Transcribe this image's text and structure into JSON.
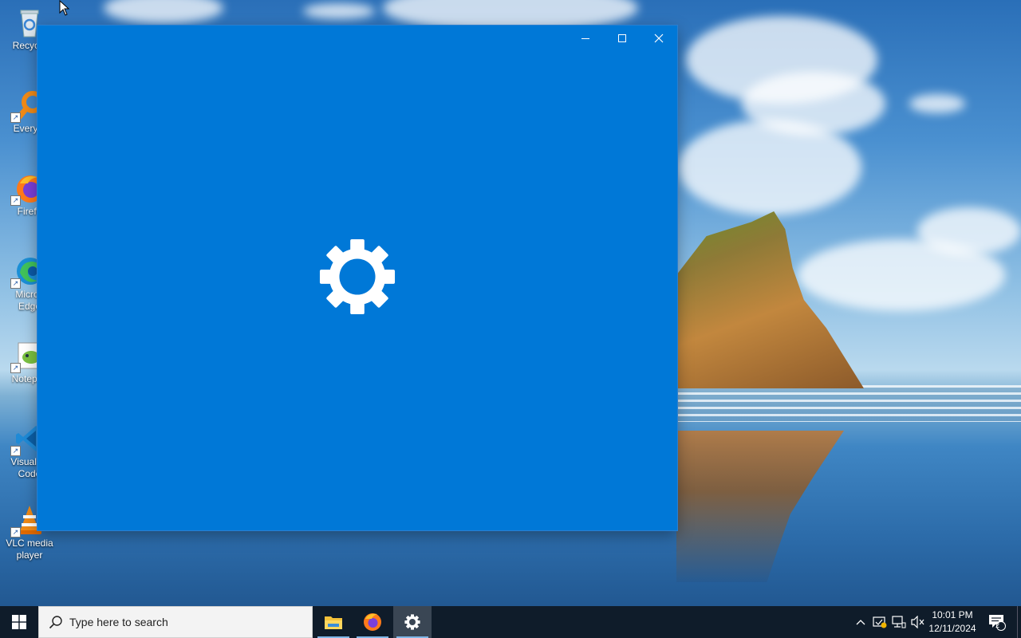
{
  "desktop": {
    "icons": [
      {
        "label": "Recycle",
        "icon": "recycle-bin-icon"
      },
      {
        "label": "Everyth",
        "icon": "everything-search-icon"
      },
      {
        "label": "Firefo",
        "icon": "firefox-icon"
      },
      {
        "label": "Micros Edge",
        "icon": "edge-icon"
      },
      {
        "label": "Notepac",
        "icon": "notepad-plus-plus-icon"
      },
      {
        "label": "Visual St Code",
        "icon": "vscode-icon"
      },
      {
        "label": "VLC media player",
        "icon": "vlc-icon"
      }
    ]
  },
  "window": {
    "app": "Settings",
    "state": "loading splash",
    "background": "#0078d7",
    "center_icon": "gear-icon",
    "controls": [
      "minimize-icon",
      "maximize-icon",
      "close-icon"
    ]
  },
  "taskbar": {
    "search_placeholder": "Type here to search",
    "pinned": [
      "file-explorer-icon",
      "firefox-icon",
      "settings-gear-icon"
    ],
    "active_app": "Settings",
    "tray_icons": [
      "chevron-up-icon",
      "security-icon",
      "network-icon",
      "volume-muted-icon"
    ],
    "time": "10:01 PM",
    "date": "12/11/2024",
    "notification_count": "2"
  }
}
